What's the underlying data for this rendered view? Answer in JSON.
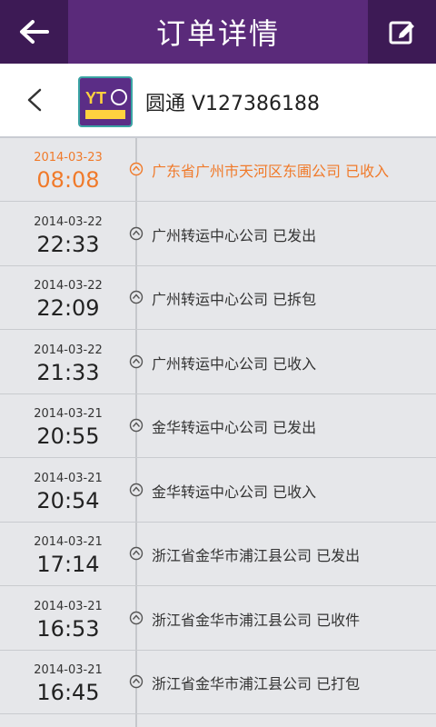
{
  "topbar": {
    "title": "订单详情",
    "left_icon": "back-arrow-icon",
    "right_icon": "edit-icon"
  },
  "header": {
    "carrier_text": "圆通 V127386188",
    "logo_icon": "yto-express-logo"
  },
  "colors": {
    "accent": "#5a2a7a",
    "active": "#f07a2a"
  },
  "tracking": [
    {
      "date": "2014-03-23",
      "time": "08:08",
      "status": "广东省广州市天河区东圃公司 已收入",
      "active": true
    },
    {
      "date": "2014-03-22",
      "time": "22:33",
      "status": "广州转运中心公司 已发出"
    },
    {
      "date": "2014-03-22",
      "time": "22:09",
      "status": "广州转运中心公司 已拆包"
    },
    {
      "date": "2014-03-22",
      "time": "21:33",
      "status": "广州转运中心公司 已收入"
    },
    {
      "date": "2014-03-21",
      "time": "20:55",
      "status": "金华转运中心公司 已发出"
    },
    {
      "date": "2014-03-21",
      "time": "20:54",
      "status": "金华转运中心公司 已收入"
    },
    {
      "date": "2014-03-21",
      "time": "17:14",
      "status": "浙江省金华市浦江县公司 已发出"
    },
    {
      "date": "2014-03-21",
      "time": "16:53",
      "status": "浙江省金华市浦江县公司 已收件"
    },
    {
      "date": "2014-03-21",
      "time": "16:45",
      "status": "浙江省金华市浦江县公司 已打包"
    }
  ]
}
